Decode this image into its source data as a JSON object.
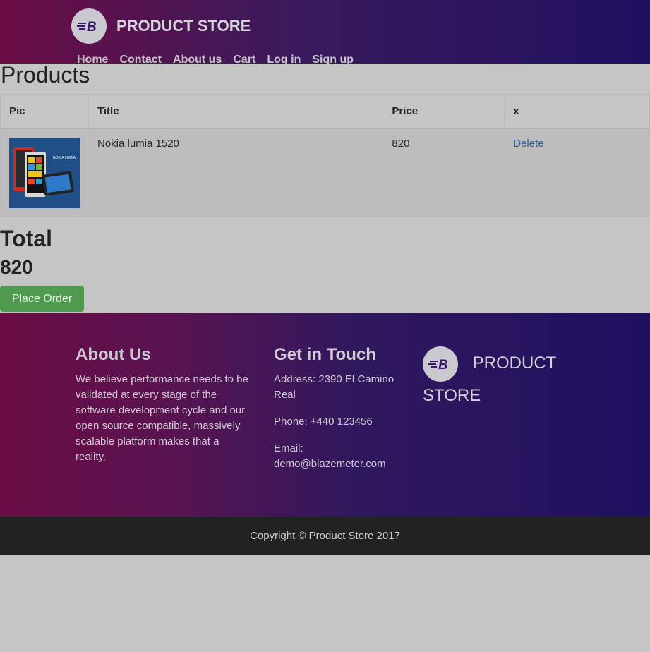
{
  "navbar": {
    "brand": "PRODUCT STORE",
    "links": [
      "Home",
      "Contact",
      "About us",
      "Cart",
      "Log in",
      "Sign up"
    ]
  },
  "products": {
    "title": "Products",
    "columns": [
      "Pic",
      "Title",
      "Price",
      "x"
    ],
    "rows": [
      {
        "title": "Nokia lumia 1520",
        "price": "820",
        "action": "Delete",
        "image_text": "NOKIA LUMIA"
      }
    ]
  },
  "total": {
    "label": "Total",
    "value": "820"
  },
  "place_order_label": "Place Order",
  "footer": {
    "about_title": "About Us",
    "about_text": "We believe performance needs to be validated at every stage of the software development cycle and our open source compatible, massively scalable platform makes that a reality.",
    "touch_title": "Get in Touch",
    "address": "Address: 2390 El Camino Real",
    "phone": "Phone: +440 123456",
    "email_label": "Email:",
    "email": "demo@blazemeter.com",
    "brand_line1": "PRODUCT",
    "brand_line2": "STORE"
  },
  "copyright": "Copyright © Product Store 2017",
  "colors": {
    "primary_gradient_start": "#6b0d45",
    "primary_gradient_end": "#201060",
    "order_button": "#4f9a4f",
    "link": "#2c5f99"
  }
}
